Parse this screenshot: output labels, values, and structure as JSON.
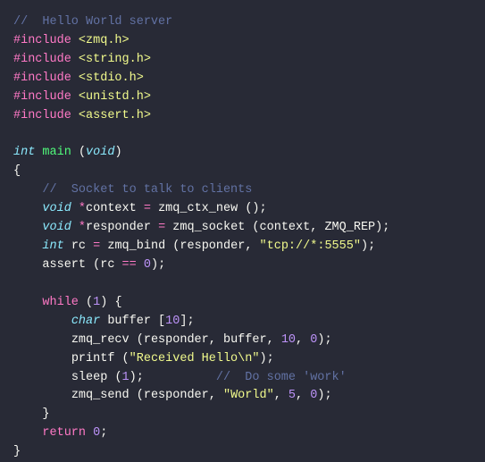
{
  "code": {
    "c0": "//  Hello World server",
    "inc": "#include",
    "h1": "<zmq.h>",
    "h2": "<string.h>",
    "h3": "<stdio.h>",
    "h4": "<unistd.h>",
    "h5": "<assert.h>",
    "int": "int",
    "void": "void",
    "char": "char",
    "main": "main",
    "lp": "(",
    "rp": ")",
    "lb": "{",
    "rb": "}",
    "c1": "//  Socket to talk to clients",
    "star": "*",
    "context": "context",
    "eq": "=",
    "zmq_ctx_new": "zmq_ctx_new",
    "semi": ";",
    "responder": "responder",
    "zmq_socket": "zmq_socket",
    "comma": ",",
    "ZMQ_REP": "ZMQ_REP",
    "rc": "rc",
    "zmq_bind": "zmq_bind",
    "s_tcp": "\"tcp://*:5555\"",
    "assert": "assert",
    "eqeq": "==",
    "n0": "0",
    "n1": "1",
    "n5": "5",
    "n10": "10",
    "while": "while",
    "buffer": "buffer",
    "lbr": "[",
    "rbr": "]",
    "zmq_recv": "zmq_recv",
    "printf": "printf",
    "s_recv": "\"Received Hello\\n\"",
    "sleep": "sleep",
    "c2": "//  Do some 'work'",
    "zmq_send": "zmq_send",
    "s_world": "\"World\"",
    "return": "return"
  }
}
